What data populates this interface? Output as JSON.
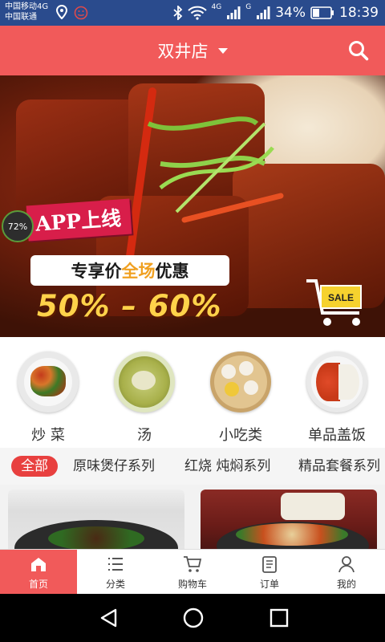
{
  "status_bar": {
    "carrier_1": "中国移动4G",
    "carrier_2": "中国联通",
    "net_1": "4G",
    "net_2": "G",
    "battery": "34%",
    "time": "18:39",
    "icons": [
      "location-icon",
      "smiley-icon",
      "bluetooth-icon",
      "wifi-icon",
      "signal-icon",
      "battery-icon"
    ]
  },
  "header": {
    "store_name": "双井店",
    "icons": [
      "chevron-down-icon",
      "search-icon"
    ],
    "color": "#f15a5a"
  },
  "banner": {
    "badge": "72%",
    "app_online": "APP上线",
    "promo_prefix": "专享价",
    "promo_highlight": "全场",
    "promo_suffix": "优惠",
    "discount": "50% – 60%",
    "sale": "SALE"
  },
  "categories": [
    {
      "label": "炒 菜",
      "icon": "stir-fry-dish-icon"
    },
    {
      "label": "汤",
      "icon": "soup-bowl-icon"
    },
    {
      "label": "小吃类",
      "icon": "snack-plate-icon"
    },
    {
      "label": "单品盖饭",
      "icon": "rice-bowl-icon"
    }
  ],
  "tabs": [
    {
      "label": "全部",
      "active": true
    },
    {
      "label": "原味煲仔系列",
      "active": false
    },
    {
      "label": "红烧 炖焖系列",
      "active": false
    },
    {
      "label": "精品套餐系列",
      "active": false
    }
  ],
  "bottom_nav": [
    {
      "label": "首页",
      "icon": "home-icon",
      "active": true
    },
    {
      "label": "分类",
      "icon": "list-icon",
      "active": false
    },
    {
      "label": "购物车",
      "icon": "cart-icon",
      "active": false
    },
    {
      "label": "订单",
      "icon": "order-icon",
      "active": false
    },
    {
      "label": "我的",
      "icon": "user-icon",
      "active": false
    }
  ],
  "colors": {
    "accent": "#f15a5a",
    "status_bar": "#2a4b8d",
    "tab_active": "#e8403f"
  }
}
